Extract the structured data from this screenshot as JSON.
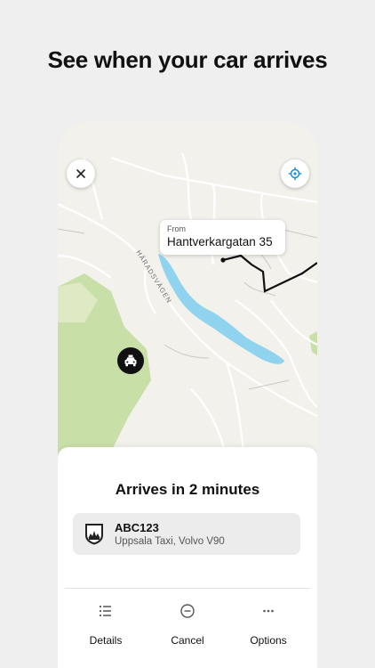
{
  "headline": "See when your car arrives",
  "map": {
    "road_label": "HÄRADSVÄGEN",
    "pickup": {
      "from_label": "From",
      "address": "Hantverkargatan 35"
    },
    "icons": {
      "close": "close-icon",
      "locate": "locate-icon",
      "taxi": "taxi-icon"
    }
  },
  "sheet": {
    "status": "Arrives in 2 minutes",
    "car": {
      "plate": "ABC123",
      "description": "Uppsala Taxi, Volvo V90",
      "logo": "taxi-company-logo"
    },
    "actions": [
      {
        "label": "Details",
        "icon": "list-icon"
      },
      {
        "label": "Cancel",
        "icon": "minus-circle-icon"
      },
      {
        "label": "Options",
        "icon": "more-icon"
      }
    ]
  },
  "colors": {
    "water": "#8fd3ee",
    "park": "#c9dfa8",
    "land": "#f2f1ec",
    "route": "#111111"
  }
}
